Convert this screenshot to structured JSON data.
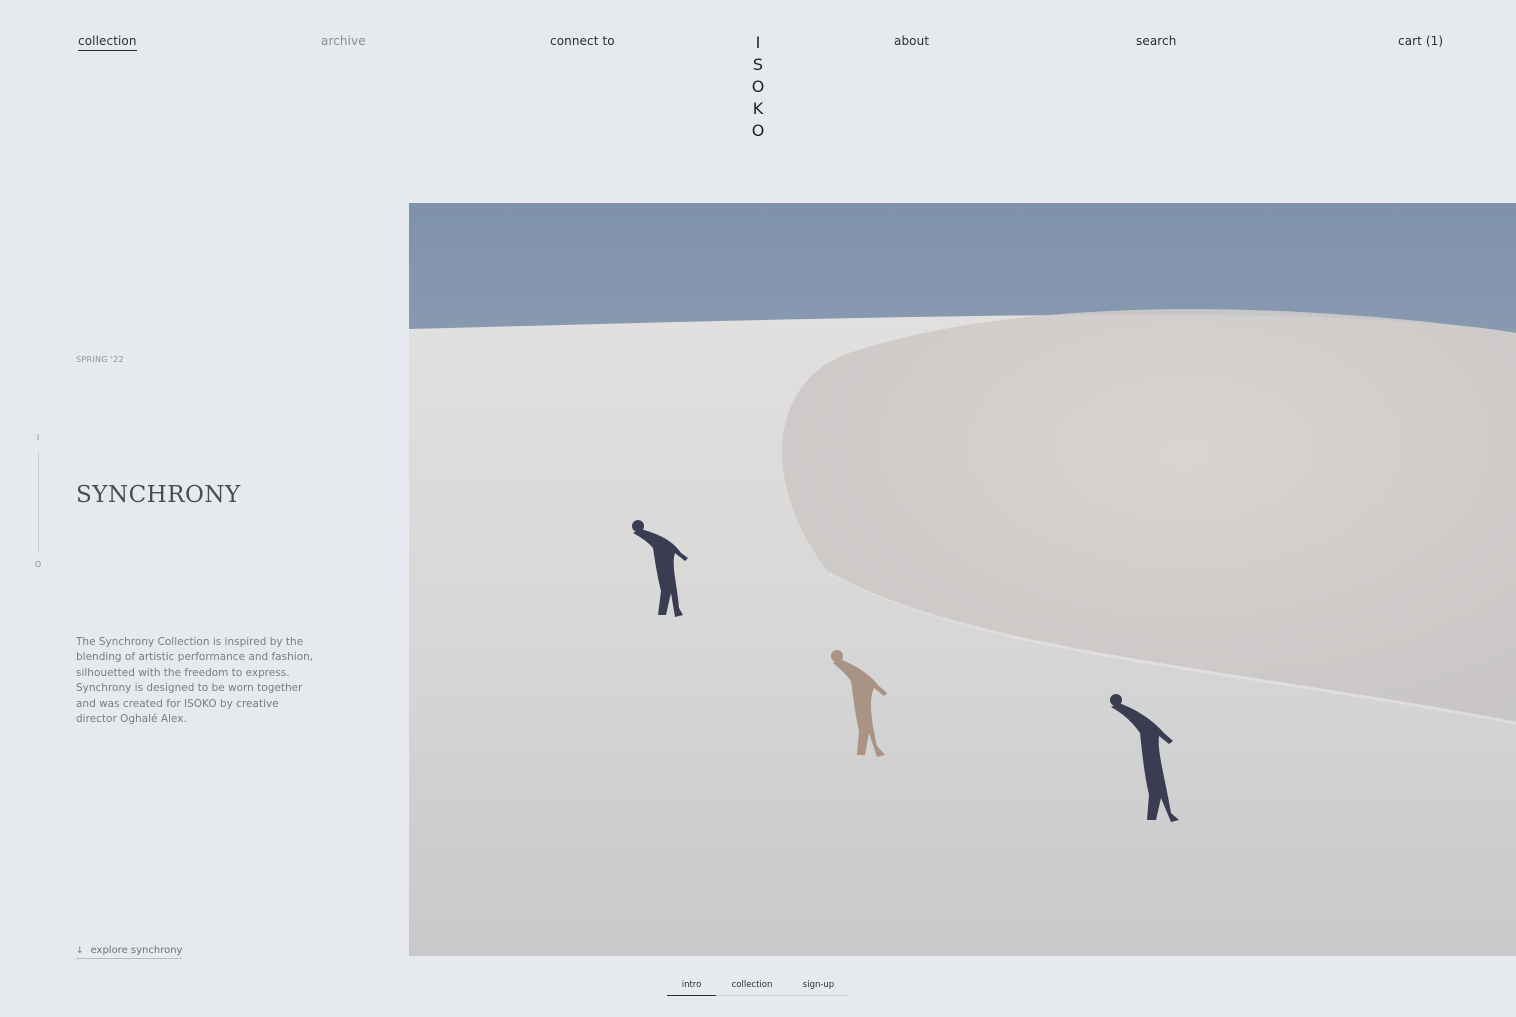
{
  "nav": {
    "collection": "collection",
    "archive": "archive",
    "connect": "connect to",
    "about": "about",
    "search": "search",
    "cart": "cart (1)"
  },
  "logo": {
    "letters": [
      "I",
      "S",
      "O",
      "K",
      "O"
    ]
  },
  "intro": {
    "season": "SPRING '22",
    "pager_top": "I",
    "pager_bottom": "O",
    "title": "SYNCHRONY",
    "description": "The Synchrony Collection is inspired by the blending of artistic performance and fashion, silhouetted with the freedom to express. Synchrony is designed to be worn together and was created for ISOKO by creative director Oghalé Alex.",
    "explore_icon": "arrow-down-icon",
    "explore_label": "explore synchrony"
  },
  "tabs": {
    "intro": "intro",
    "collection": "collection",
    "signup": "sign-up",
    "active": "intro"
  },
  "colors": {
    "background": "#e6e9ed",
    "text": "#2b2d33",
    "sky": "#8093ac",
    "sand": "#d9d8d8"
  }
}
